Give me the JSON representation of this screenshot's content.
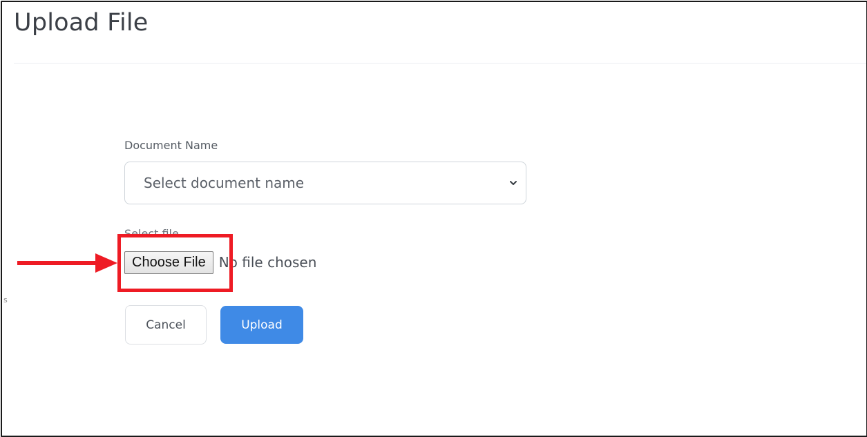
{
  "page": {
    "title": "Upload File"
  },
  "form": {
    "document_name_label": "Document Name",
    "document_select": {
      "selected": "Select document name"
    },
    "select_file_label": "Select file",
    "file_input": {
      "button_label": "Choose File",
      "status": "No file chosen"
    },
    "cancel_label": "Cancel",
    "upload_label": "Upload"
  },
  "annotation": {
    "stray_mark": "s"
  },
  "colors": {
    "primary_button": "#3f8ae6",
    "highlight": "#ee1b24",
    "arrow": "#ee1b24",
    "frame_border": "#1a1a1a",
    "divider": "#eceef1"
  },
  "icons": {
    "select_dropdown": "chevron-down-icon",
    "annotation_pointer": "arrow-right-icon"
  }
}
